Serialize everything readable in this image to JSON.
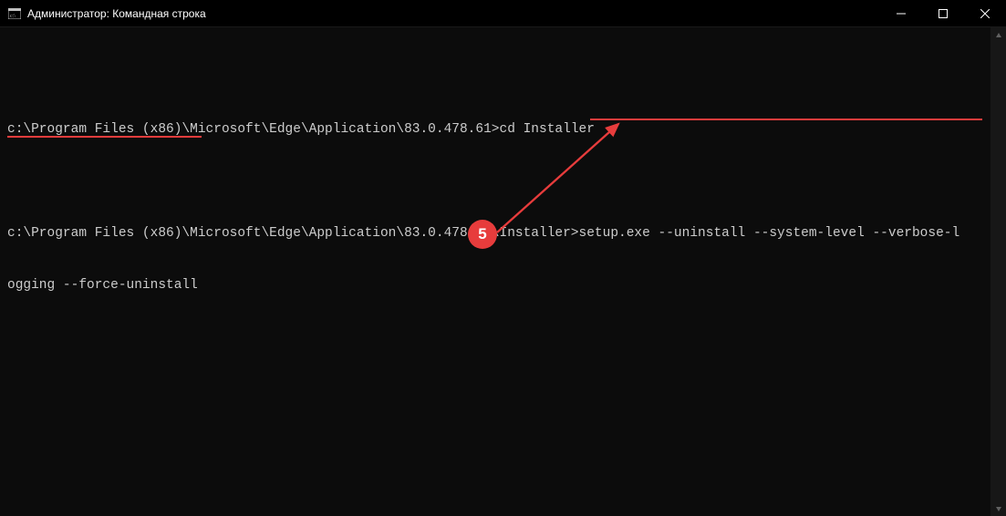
{
  "window": {
    "title": "Администратор: Командная строка"
  },
  "terminal": {
    "line1_prompt_prefix": "c:\\Program Files (x86)\\Microsoft\\Edge\\Application\\83.0.478.61>",
    "line1_command": "cd Installer",
    "line2_prompt_prefix": "c:\\Program Files (x86)\\Microsoft\\Edge\\Application\\83.0.478.61\\Installer>",
    "line2_command_part1": "setup.exe --uninstall --system-level --verbose-l",
    "line2_command_part2": "ogging --force-uninstall"
  },
  "annotation": {
    "badge_label": "5",
    "color": "#e73c3c"
  }
}
